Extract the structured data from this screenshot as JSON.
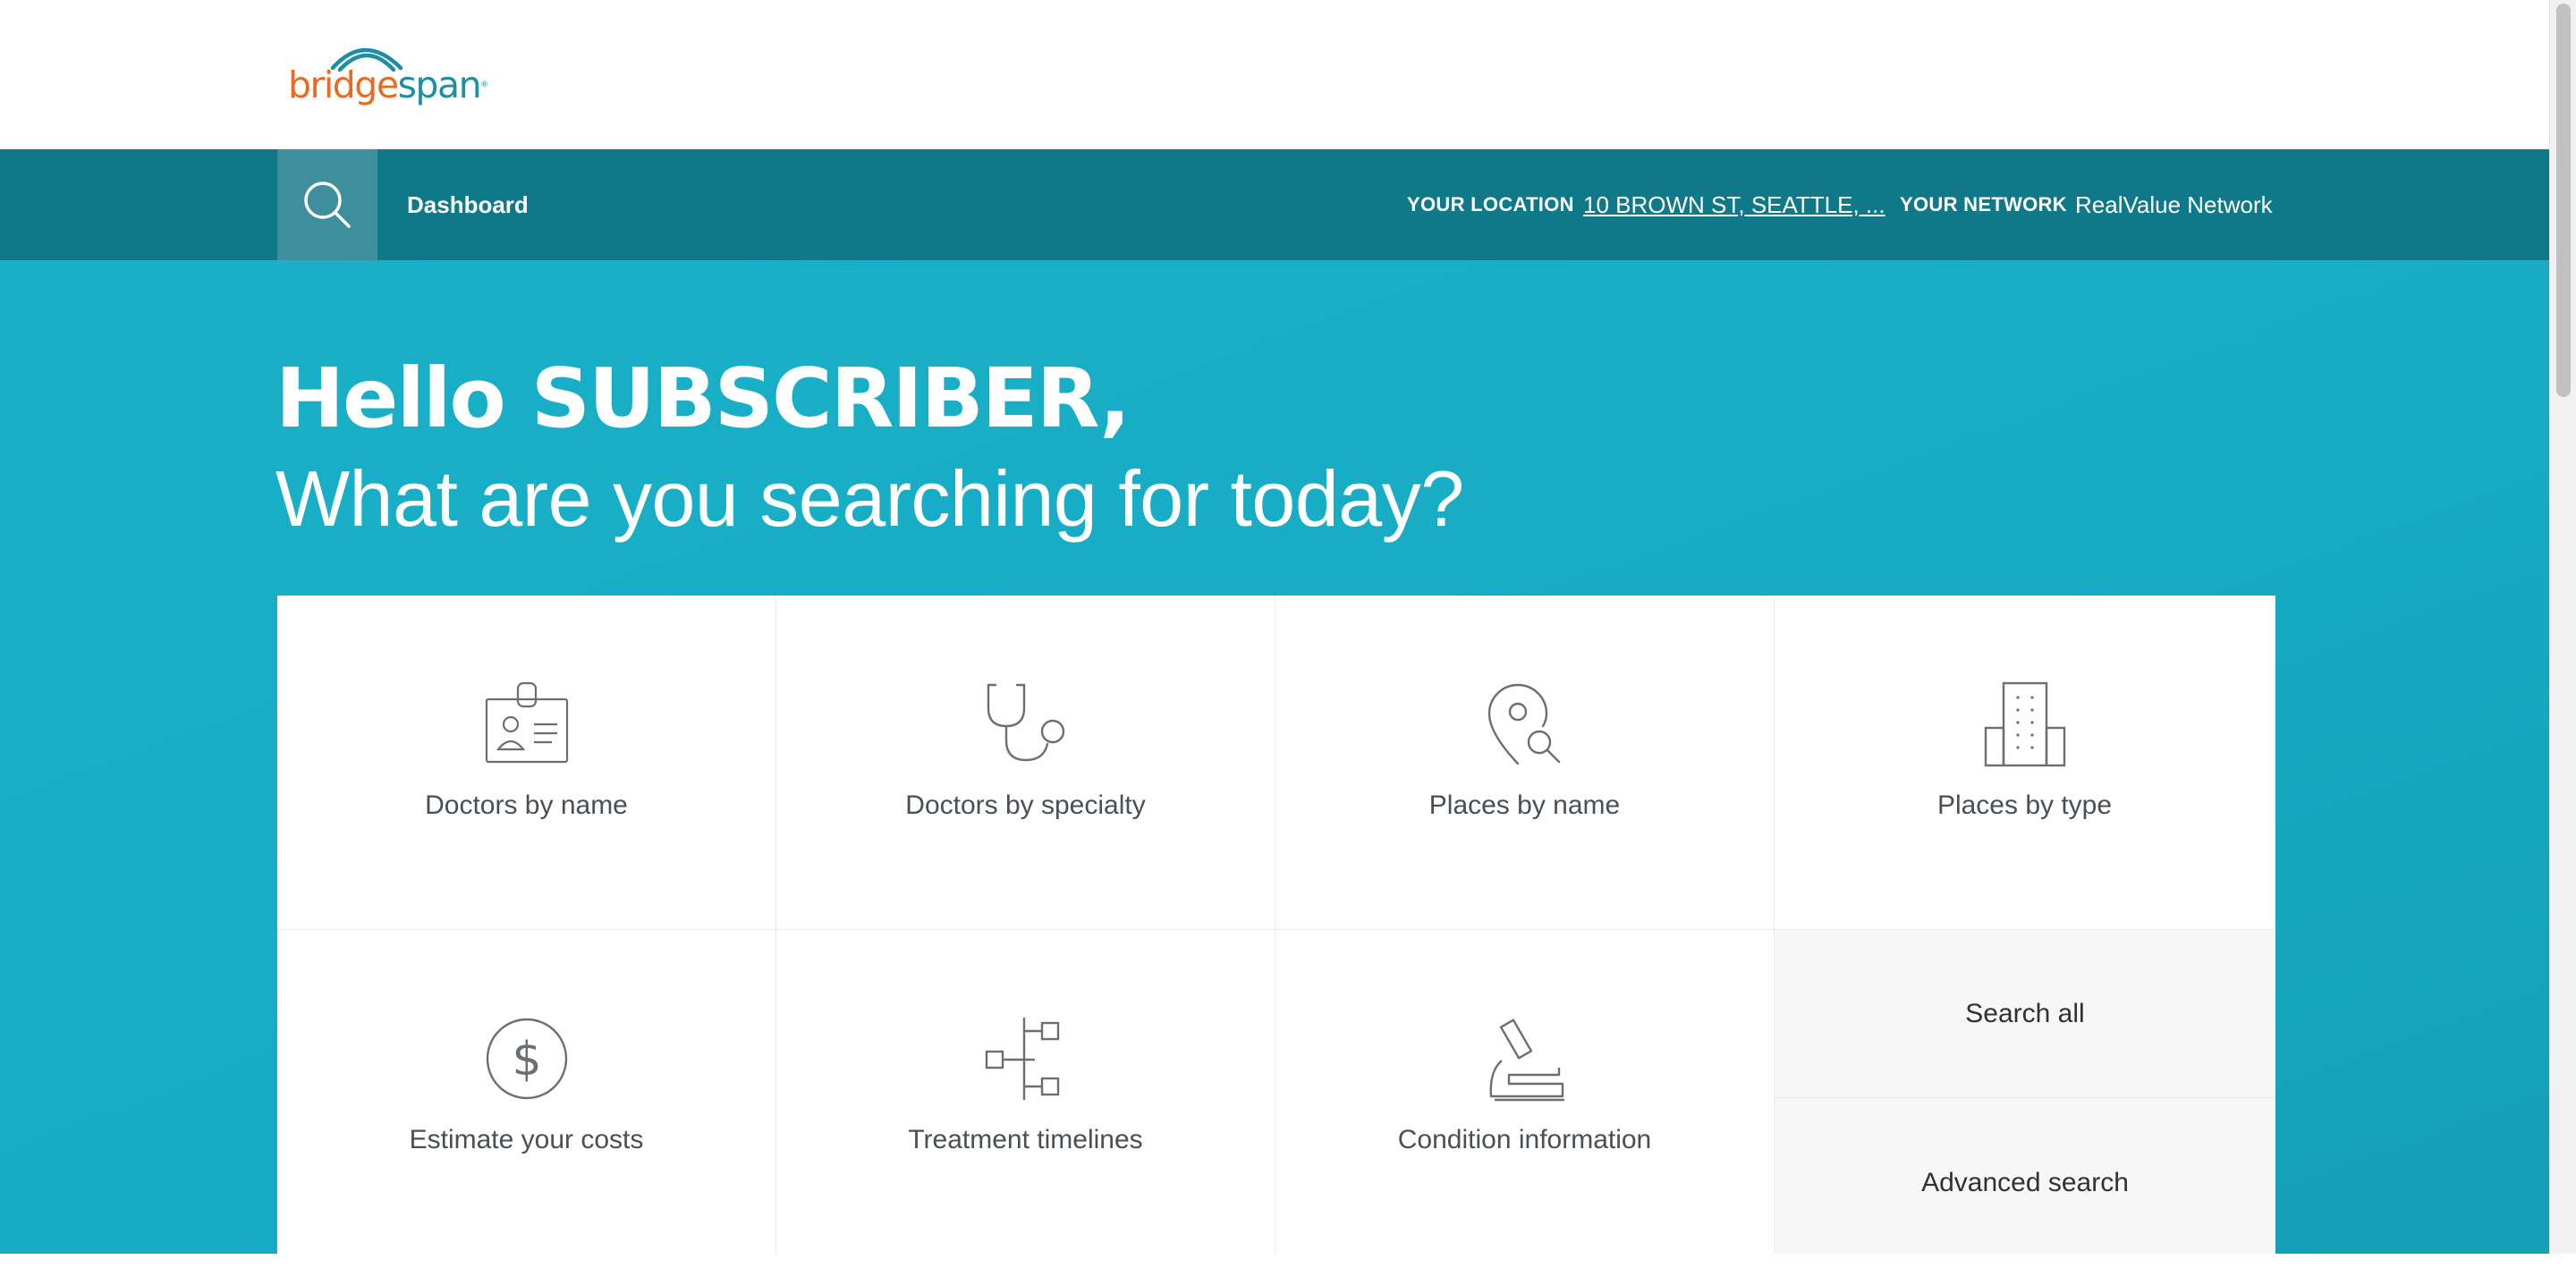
{
  "brand": {
    "logo_part1": "bridge",
    "logo_part2": "span",
    "logo_mark": "®",
    "color_orange": "#e86b23",
    "color_teal": "#1d8ea3"
  },
  "nav": {
    "search_icon": "search-icon",
    "dashboard_label": "Dashboard",
    "location_label": "YOUR LOCATION",
    "location_value": "10 BROWN ST, SEATTLE, ...",
    "network_label": "YOUR NETWORK",
    "network_value": "RealValue Network",
    "bar_color": "#0f7889"
  },
  "hero": {
    "greeting": "Hello SUBSCRIBER,",
    "subheading": "What are you searching for today?",
    "background_color": "#17abc4"
  },
  "tiles": [
    {
      "label": "Doctors by name",
      "icon": "id-badge-icon"
    },
    {
      "label": "Doctors by specialty",
      "icon": "stethoscope-icon"
    },
    {
      "label": "Places by name",
      "icon": "location-search-icon"
    },
    {
      "label": "Places by type",
      "icon": "building-icon"
    },
    {
      "label": "Estimate your costs",
      "icon": "dollar-circle-icon"
    },
    {
      "label": "Treatment timelines",
      "icon": "timeline-icon"
    },
    {
      "label": "Condition information",
      "icon": "microscope-icon"
    }
  ],
  "side_actions": {
    "search_all": "Search all",
    "advanced_search": "Advanced search"
  }
}
